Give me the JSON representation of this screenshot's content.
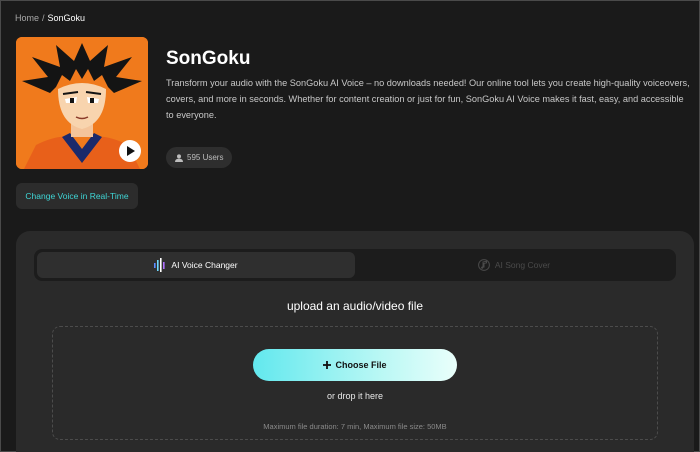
{
  "breadcrumb": {
    "home": "Home",
    "separator": "/",
    "current": "SonGoku"
  },
  "voice": {
    "title": "SonGoku",
    "description": "Transform your audio with the SonGoku AI Voice – no downloads needed! Our online tool lets you create high-quality voiceovers, covers, and more in seconds. Whether for content creation or just for fun, SonGoku AI Voice makes it fast, easy, and accessible to everyone.",
    "users": "595 Users",
    "realtime_button": "Change Voice in Real-Time"
  },
  "tabs": [
    {
      "label": "AI Voice Changer",
      "icon": "voice-wave-icon",
      "active": true
    },
    {
      "label": "AI Song Cover",
      "icon": "music-note-icon",
      "active": false
    }
  ],
  "upload": {
    "title": "upload an audio/video file",
    "choose_label": "Choose File",
    "drop_text": "or drop it here",
    "limits": "Maximum file duration: 7 min, Maximum file size: 50MB"
  },
  "colors": {
    "background": "#1a1a1a",
    "panel": "#2a2a2a",
    "accent_cyan": "#3fd6d6",
    "cover_orange": "#f07a1c"
  }
}
